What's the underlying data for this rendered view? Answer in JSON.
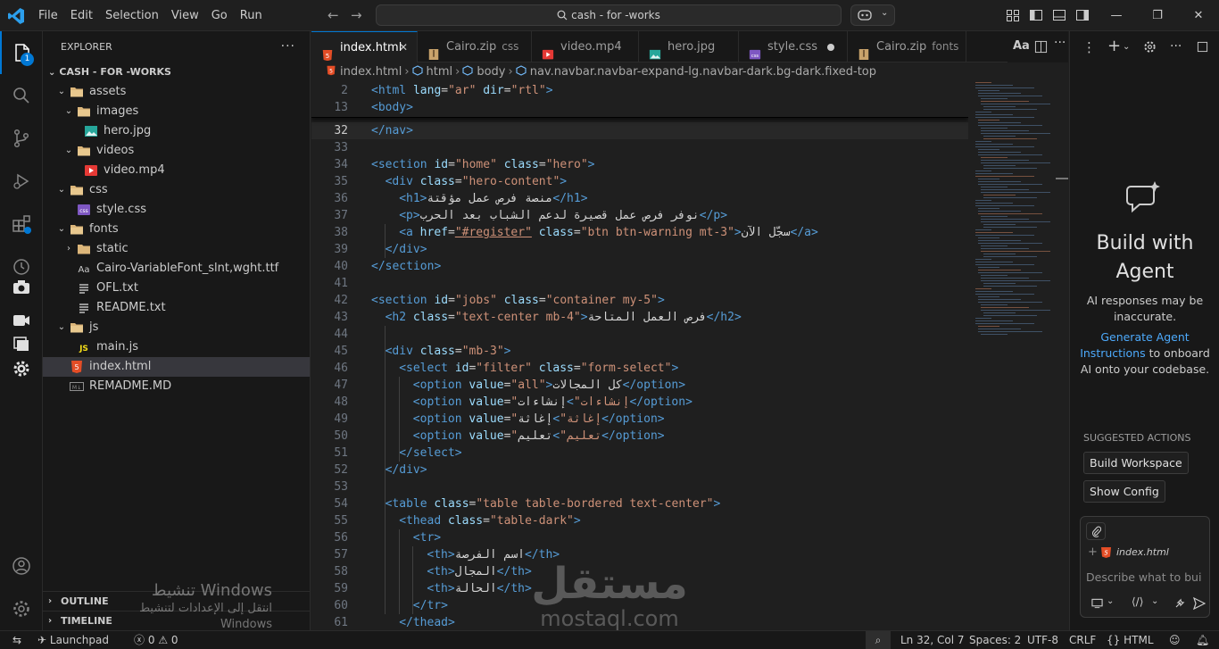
{
  "titlebar": {
    "menu": [
      "File",
      "Edit",
      "Selection",
      "View",
      "Go",
      "Run"
    ],
    "search": "cash - for -works"
  },
  "activity": {
    "explorer_badge": "1",
    "icons": [
      "files-icon",
      "search-icon",
      "source-control-icon",
      "run-debug-icon",
      "extensions-icon",
      "timeline-icon",
      "camera-icon",
      "video-icon",
      "copy-icon",
      "settings-gear-icon"
    ]
  },
  "explorer": {
    "title": "EXPLORER",
    "folder": "CASH - FOR -WORKS",
    "tree": [
      {
        "label": "assets",
        "depth": 1,
        "type": "folder",
        "open": true
      },
      {
        "label": "images",
        "depth": 2,
        "type": "folder",
        "open": true
      },
      {
        "label": "hero.jpg",
        "depth": 3,
        "type": "image"
      },
      {
        "label": "videos",
        "depth": 2,
        "type": "folder",
        "open": true
      },
      {
        "label": "video.mp4",
        "depth": 3,
        "type": "video"
      },
      {
        "label": "css",
        "depth": 1,
        "type": "folder",
        "open": true
      },
      {
        "label": "style.css",
        "depth": 2,
        "type": "css"
      },
      {
        "label": "fonts",
        "depth": 1,
        "type": "folder",
        "open": true
      },
      {
        "label": "static",
        "depth": 2,
        "type": "folder",
        "open": false
      },
      {
        "label": "Cairo-VariableFont_slnt,wght.ttf",
        "depth": 2,
        "type": "font"
      },
      {
        "label": "OFL.txt",
        "depth": 2,
        "type": "text"
      },
      {
        "label": "README.txt",
        "depth": 2,
        "type": "text"
      },
      {
        "label": "js",
        "depth": 1,
        "type": "folder",
        "open": true
      },
      {
        "label": "main.js",
        "depth": 2,
        "type": "js"
      },
      {
        "label": "index.html",
        "depth": 1,
        "type": "html",
        "selected": true
      },
      {
        "label": "REMADME.MD",
        "depth": 1,
        "type": "md"
      }
    ],
    "outline": "OUTLINE",
    "timeline": "TIMELINE"
  },
  "tabs": [
    {
      "label": "index.html",
      "hint": "",
      "type": "html",
      "active": true,
      "state": "close"
    },
    {
      "label": "Cairo.zip",
      "hint": "css",
      "type": "zip"
    },
    {
      "label": "video.mp4",
      "hint": "",
      "type": "video"
    },
    {
      "label": "hero.jpg",
      "hint": "",
      "type": "image"
    },
    {
      "label": "style.css",
      "hint": "",
      "type": "css",
      "state": "dirty"
    },
    {
      "label": "Cairo.zip",
      "hint": "fonts",
      "type": "zip"
    }
  ],
  "breadcrumb": [
    "index.html",
    "html",
    "body",
    "nav.navbar.navbar-expand-lg.navbar-dark.bg-dark.fixed-top"
  ],
  "code": {
    "sticky": [
      {
        "n": "2",
        "indent": 0,
        "html": "<span class=\"tg\">&lt;html</span> <span class=\"at\">lang</span>=<span class=\"st\">\"ar\"</span> <span class=\"at\">dir</span>=<span class=\"st\">\"rtl\"</span><span class=\"tg\">&gt;</span>"
      },
      {
        "n": "13",
        "indent": 0,
        "html": "<span class=\"tg\">&lt;body&gt;</span>"
      }
    ],
    "lines": [
      {
        "n": "32",
        "indent": 0,
        "current": true,
        "html": "<span class=\"tg\">&lt;/nav&gt;</span>"
      },
      {
        "n": "33",
        "indent": 0,
        "html": ""
      },
      {
        "n": "34",
        "indent": 0,
        "html": "<span class=\"tg\">&lt;section</span> <span class=\"at\">id</span>=<span class=\"st\">\"home\"</span> <span class=\"at\">class</span>=<span class=\"st\">\"hero\"</span><span class=\"tg\">&gt;</span>"
      },
      {
        "n": "35",
        "indent": 1,
        "html": "<span class=\"tg\">&lt;div</span> <span class=\"at\">class</span>=<span class=\"st\">\"hero-content\"</span><span class=\"tg\">&gt;</span>"
      },
      {
        "n": "36",
        "indent": 2,
        "html": "<span class=\"tg\">&lt;h1&gt;</span><span class=\"tx\">منصة فرص عمل مؤقتة</span><span class=\"tg\">&lt;/h1&gt;</span>"
      },
      {
        "n": "37",
        "indent": 2,
        "html": "<span class=\"tg\">&lt;p&gt;</span><span class=\"tx\">نوفر فرص عمل قصيرة لدعم الشباب بعد الحرب</span><span class=\"tg\">&lt;/p&gt;</span>"
      },
      {
        "n": "38",
        "indent": 2,
        "html": "<span class=\"tg\">&lt;a</span> <span class=\"at\">href</span>=<span class=\"st\" style=\"text-decoration:underline\">\"#register\"</span> <span class=\"at\">class</span>=<span class=\"st\">\"btn btn-warning mt-3\"</span><span class=\"tg\">&gt;</span><span class=\"tx\">سجّل الآن</span><span class=\"tg\">&lt;/a&gt;</span>"
      },
      {
        "n": "39",
        "indent": 1,
        "html": "<span class=\"tg\">&lt;/div&gt;</span>"
      },
      {
        "n": "40",
        "indent": 0,
        "html": "<span class=\"tg\">&lt;/section&gt;</span>"
      },
      {
        "n": "41",
        "indent": 0,
        "html": ""
      },
      {
        "n": "42",
        "indent": 0,
        "html": "<span class=\"tg\">&lt;section</span> <span class=\"at\">id</span>=<span class=\"st\">\"jobs\"</span> <span class=\"at\">class</span>=<span class=\"st\">\"container my-5\"</span><span class=\"tg\">&gt;</span>"
      },
      {
        "n": "43",
        "indent": 1,
        "html": "<span class=\"tg\">&lt;h2</span> <span class=\"at\">class</span>=<span class=\"st\">\"text-center mb-4\"</span><span class=\"tg\">&gt;</span><span class=\"tx\">فرص العمل المتاحة</span><span class=\"tg\">&lt;/h2&gt;</span>"
      },
      {
        "n": "44",
        "indent": 0,
        "html": ""
      },
      {
        "n": "45",
        "indent": 1,
        "html": "<span class=\"tg\">&lt;div</span> <span class=\"at\">class</span>=<span class=\"st\">\"mb-3\"</span><span class=\"tg\">&gt;</span>"
      },
      {
        "n": "46",
        "indent": 2,
        "html": "<span class=\"tg\">&lt;select</span> <span class=\"at\">id</span>=<span class=\"st\">\"filter\"</span> <span class=\"at\">class</span>=<span class=\"st\">\"form-select\"</span><span class=\"tg\">&gt;</span>"
      },
      {
        "n": "47",
        "indent": 3,
        "html": "<span class=\"tg\">&lt;option</span> <span class=\"at\">value</span>=<span class=\"st\">\"all\"</span><span class=\"tg\">&gt;</span><span class=\"tx\">كل المجالات</span><span class=\"tg\">&lt;/option&gt;</span>"
      },
      {
        "n": "48",
        "indent": 3,
        "html": "<span class=\"tg\">&lt;option</span> <span class=\"at\">value</span>=<span class=\"st\">\"إنشاءات\"</span><span class=\"tg\">&gt;</span><span class=\"tx\">إنشاءات</span><span class=\"tg\">&lt;/option&gt;</span>"
      },
      {
        "n": "49",
        "indent": 3,
        "html": "<span class=\"tg\">&lt;option</span> <span class=\"at\">value</span>=<span class=\"st\">\"إغاثة\"</span><span class=\"tg\">&gt;</span><span class=\"tx\">إغاثة</span><span class=\"tg\">&lt;/option&gt;</span>"
      },
      {
        "n": "50",
        "indent": 3,
        "html": "<span class=\"tg\">&lt;option</span> <span class=\"at\">value</span>=<span class=\"st\">\"تعليم\"</span><span class=\"tg\">&gt;</span><span class=\"tx\">تعليم</span><span class=\"tg\">&lt;/option&gt;</span>"
      },
      {
        "n": "51",
        "indent": 2,
        "html": "<span class=\"tg\">&lt;/select&gt;</span>"
      },
      {
        "n": "52",
        "indent": 1,
        "html": "<span class=\"tg\">&lt;/div&gt;</span>"
      },
      {
        "n": "53",
        "indent": 0,
        "html": ""
      },
      {
        "n": "54",
        "indent": 1,
        "html": "<span class=\"tg\">&lt;table</span> <span class=\"at\">class</span>=<span class=\"st\">\"table table-bordered text-center\"</span><span class=\"tg\">&gt;</span>"
      },
      {
        "n": "55",
        "indent": 2,
        "html": "<span class=\"tg\">&lt;thead</span> <span class=\"at\">class</span>=<span class=\"st\">\"table-dark\"</span><span class=\"tg\">&gt;</span>"
      },
      {
        "n": "56",
        "indent": 3,
        "html": "<span class=\"tg\">&lt;tr&gt;</span>"
      },
      {
        "n": "57",
        "indent": 4,
        "html": "<span class=\"tg\">&lt;th&gt;</span><span class=\"tx\">اسم الفرصة</span><span class=\"tg\">&lt;/th&gt;</span>"
      },
      {
        "n": "58",
        "indent": 4,
        "html": "<span class=\"tg\">&lt;th&gt;</span><span class=\"tx\">المجال</span><span class=\"tg\">&lt;/th&gt;</span>"
      },
      {
        "n": "59",
        "indent": 4,
        "html": "<span class=\"tg\">&lt;th&gt;</span><span class=\"tx\">الحالة</span><span class=\"tg\">&lt;/th&gt;</span>"
      },
      {
        "n": "60",
        "indent": 3,
        "html": "<span class=\"tg\">&lt;/tr&gt;</span>"
      },
      {
        "n": "61",
        "indent": 2,
        "html": "<span class=\"tg\">&lt;/thead&gt;</span>"
      }
    ]
  },
  "chat": {
    "title": "Build with Agent",
    "note": "AI responses may be inaccurate.",
    "link": "Generate Agent Instructions",
    "link_rest": " to onboard AI onto your codebase.",
    "suggested_label": "SUGGESTED ACTIONS",
    "actions": [
      "Build Workspace",
      "Show Config"
    ],
    "context_file": "index.html",
    "placeholder": "Describe what to build"
  },
  "status": {
    "launchpad": "Launchpad",
    "errors": "0",
    "warnings": "0",
    "position": "Ln 32, Col 7",
    "spaces": "Spaces: 2",
    "encoding": "UTF-8",
    "eol": "CRLF",
    "language": "HTML"
  },
  "watermark": {
    "windows_title": "تنشيط Windows",
    "windows_sub": "انتقل إلى الإعدادات لتنشيط Windows",
    "mostaql_ar": "مستقل",
    "mostaql_en": "mostaql.com"
  },
  "colors": {
    "accent": "#0078d4",
    "tag": "#569cd6",
    "attr": "#9cdcfe",
    "string": "#ce9178",
    "html_icon": "#e44d26"
  }
}
